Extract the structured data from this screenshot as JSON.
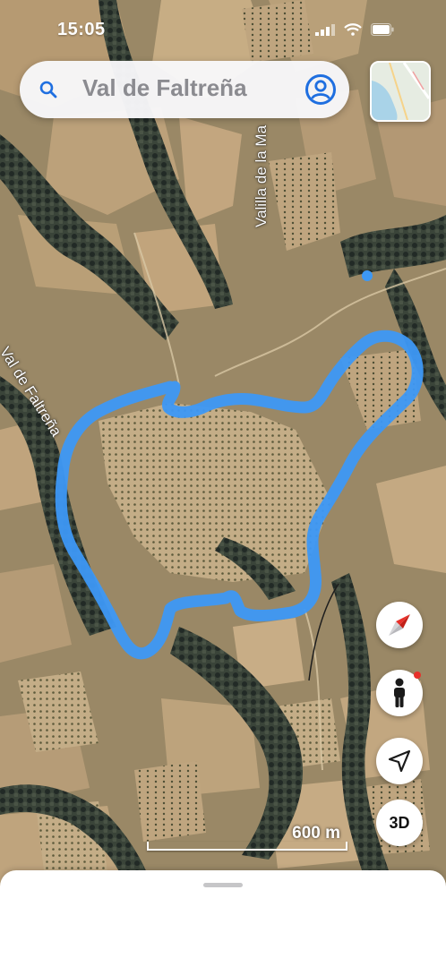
{
  "status_bar": {
    "time": "15:05"
  },
  "search": {
    "value": "Val de Faltreña",
    "icon": "search-icon"
  },
  "map": {
    "type": "satellite",
    "labels": [
      {
        "id": "valilla",
        "text": "Valilla de la Ma"
      },
      {
        "id": "valde",
        "text": "Val de Faltreña"
      }
    ],
    "route_color": "#3d98f5",
    "location_dot_color": "#3d98f5"
  },
  "controls": {
    "compass": "compass-icon",
    "person": "person-icon",
    "location": "location-arrow-icon",
    "view_3d_label": "3D"
  },
  "scale": {
    "label": "600 m"
  },
  "colors": {
    "accent": "#3d98f5",
    "notify": "#e8302a"
  }
}
